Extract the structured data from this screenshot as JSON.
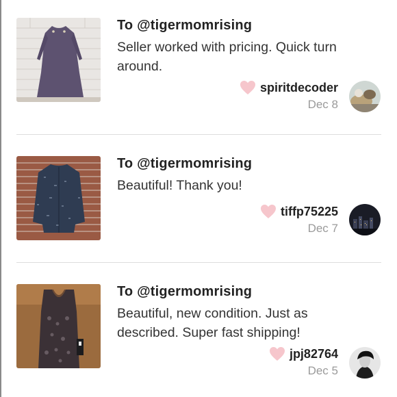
{
  "reviews": [
    {
      "to": "To @tigermomrising",
      "text": "Seller worked with pricing. Quick turn around.",
      "reviewer": "spiritdecoder",
      "date": "Dec 8",
      "item_icon": "purple-dress-photo",
      "avatar_icon": "reviewer-avatar-photo"
    },
    {
      "to": "To @tigermomrising",
      "text": "Beautiful! Thank you!",
      "reviewer": "tiffp75225",
      "date": "Dec 7",
      "item_icon": "tweed-jacket-photo",
      "avatar_icon": "city-night-avatar-photo"
    },
    {
      "to": "To @tigermomrising",
      "text": "Beautiful, new condition. Just as described. Super fast shipping!",
      "reviewer": "jpj82764",
      "date": "Dec 5",
      "item_icon": "lace-dress-photo",
      "avatar_icon": "portrait-avatar-photo"
    }
  ],
  "colors": {
    "heart": "#f6c6cc",
    "divider": "#dddddd",
    "date_text": "#9a9a9a"
  }
}
